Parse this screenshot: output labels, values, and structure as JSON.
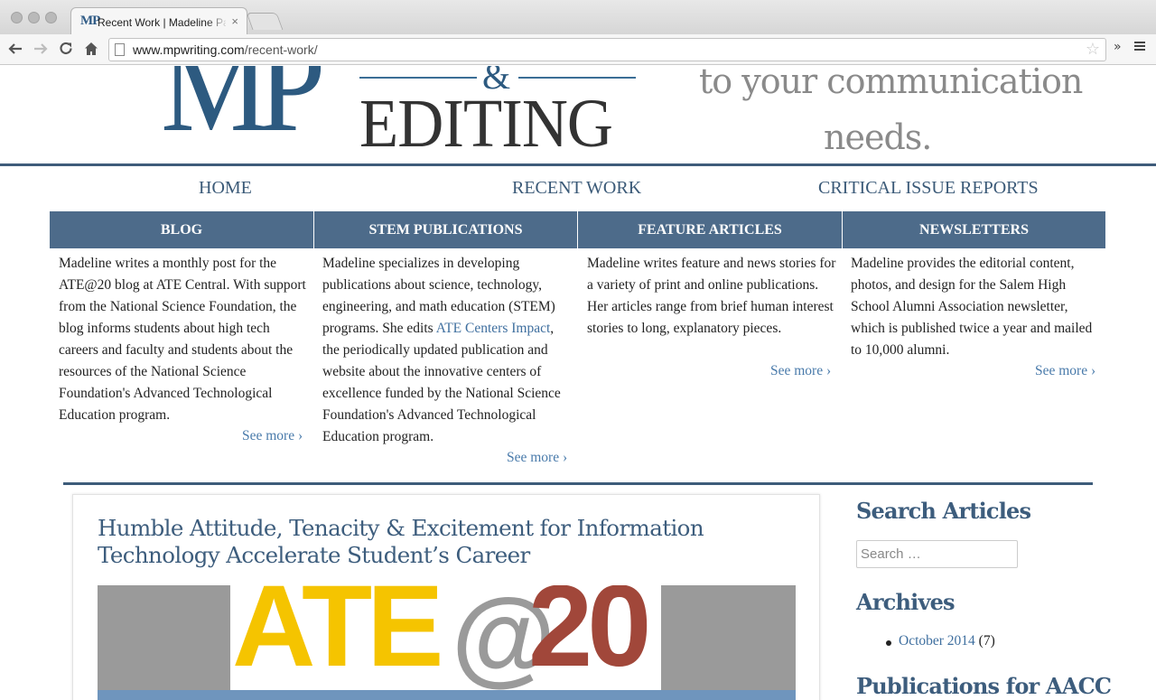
{
  "browser": {
    "tab_title": "Recent Work | Madeline Pa",
    "tab_favicon": "MP",
    "tab_close": "×",
    "url_domain": "www.mpwriting.com",
    "url_path": "/recent-work/",
    "icons": {
      "back": "back-arrow-icon",
      "forward": "forward-arrow-icon",
      "reload": "reload-icon",
      "home": "home-icon",
      "bookmark": "star-icon",
      "extensions": "chevron-double-right-icon",
      "menu": "hamburger-menu-icon"
    }
  },
  "header": {
    "logo_letters": "MP",
    "logo_amp": "&",
    "logo_editing": "EDITING",
    "tagline_line1": "to your communication",
    "tagline_line2": "needs."
  },
  "nav": {
    "items": [
      "HOME",
      "RECENT WORK",
      "CRITICAL ISSUE REPORTS"
    ]
  },
  "categories": [
    {
      "title": "BLOG",
      "body": "Madeline writes a monthly post for the ATE@20 blog at ATE Central. With support from the National Science Foundation, the blog informs students about high tech careers and faculty and students about the resources of the National Science Foundation's Advanced Technological Education program.",
      "link": "See more ›"
    },
    {
      "title": "STEM PUBLICATIONS",
      "body_before": "Madeline specializes in developing publications about science, technology, engineering, and math education (STEM) programs. She edits ",
      "body_link": "ATE Centers Impact",
      "body_after": ", the periodically updated publication and website about the innovative centers of excellence funded by the National Science Foundation's Advanced Technological Education program.",
      "link": "See more ›"
    },
    {
      "title": "FEATURE ARTICLES",
      "body": "Madeline writes feature and news stories for a variety of print and online publications. Her articles range from brief human interest stories to long, explanatory pieces.",
      "link": "See more ›"
    },
    {
      "title": "NEWSLETTERS",
      "body": "Madeline provides the editorial content, photos, and design for the Salem High School Alumni Association newsletter, which is published twice a year and mailed to 10,000 alumni.",
      "link": "See more ›"
    }
  ],
  "post": {
    "title": "Humble Attitude, Tenacity & Excitement for Information Technology Accelerate Student’s Career",
    "image_text_ate": "ATE",
    "image_text_at": "@",
    "image_text_20": "20"
  },
  "sidebar": {
    "search_heading": "Search Articles",
    "search_placeholder": "Search …",
    "archives_heading": "Archives",
    "archive_link": "October 2014",
    "archive_count": " (7)",
    "publications_heading": "Publications for AACC"
  },
  "colors": {
    "brand_blue": "#2d5a80",
    "category_header": "#4d6b8a",
    "link": "#3f6f9f",
    "ate_yellow": "#f5c400",
    "ate_red": "#a1473a"
  }
}
